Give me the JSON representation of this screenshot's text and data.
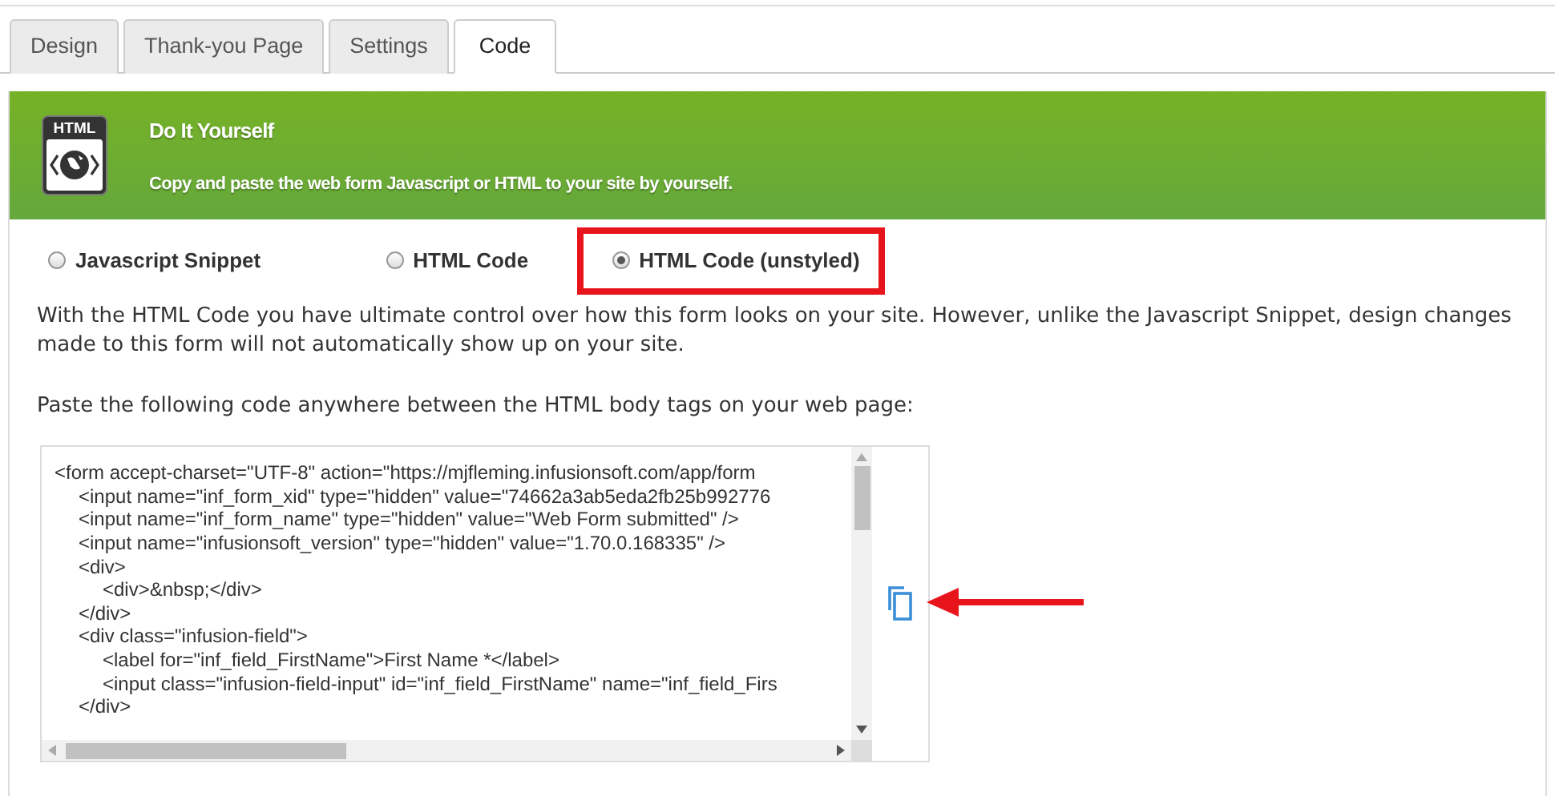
{
  "tabs": [
    {
      "label": "Design",
      "selected": false
    },
    {
      "label": "Thank-you Page",
      "selected": false
    },
    {
      "label": "Settings",
      "selected": false
    },
    {
      "label": "Code",
      "selected": true
    }
  ],
  "banner": {
    "icon_label": "HTML",
    "title": "Do It Yourself",
    "subtitle": "Copy and paste the web form Javascript or HTML to your site by yourself."
  },
  "options": [
    {
      "label": "Javascript Snippet",
      "selected": false,
      "highlighted": false
    },
    {
      "label": "HTML Code",
      "selected": false,
      "highlighted": false
    },
    {
      "label": "HTML Code (unstyled)",
      "selected": true,
      "highlighted": true
    }
  ],
  "description": "With the HTML Code you have ultimate control over how this form looks on your site. However, unlike the Javascript Snippet, design changes made to this form will not automatically show up on your site.",
  "instruction": "Paste the following code anywhere between the HTML body tags on your web page:",
  "code": {
    "lines": [
      {
        "text": "<form accept-charset=\"UTF-8\" action=\"https://mjfleming.infusionsoft.com/app/form",
        "children": [
          {
            "text": "<input name=\"inf_form_xid\" type=\"hidden\" value=\"74662a3ab5eda2fb25b992776"
          },
          {
            "text": "<input name=\"inf_form_name\" type=\"hidden\" value=\"Web Form submitted\" />"
          },
          {
            "text": "<input name=\"infusionsoft_version\" type=\"hidden\" value=\"1.70.0.168335\" />"
          },
          {
            "text": "<div>",
            "children": [
              {
                "text": "<div>&nbsp;</div>"
              }
            ]
          },
          {
            "text": "</div>"
          },
          {
            "text": "<div class=\"infusion-field\">",
            "children": [
              {
                "text": "<label for=\"inf_field_FirstName\">First Name *</label>"
              },
              {
                "text": "<input class=\"infusion-field-input\" id=\"inf_field_FirstName\" name=\"inf_field_Firs"
              }
            ]
          },
          {
            "text": "</div>"
          }
        ]
      }
    ]
  }
}
